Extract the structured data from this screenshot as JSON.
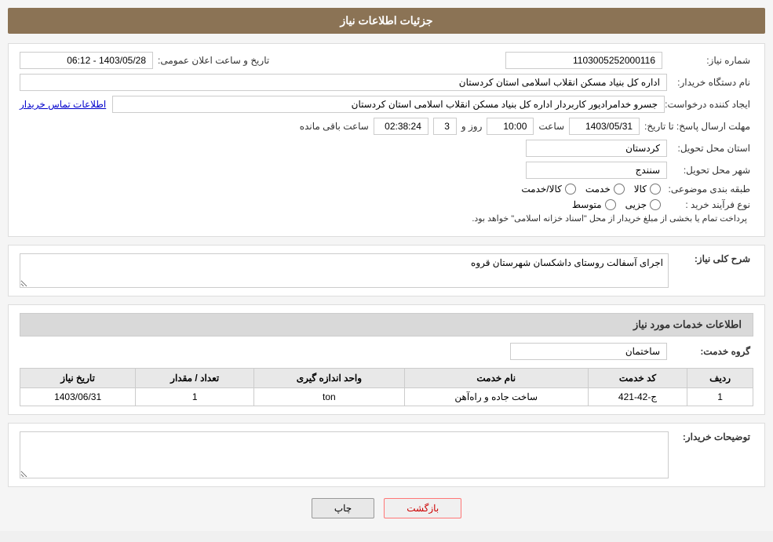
{
  "page": {
    "title": "جزئیات اطلاعات نیاز"
  },
  "header": {
    "number_label": "شماره نیاز:",
    "number_value": "1103005252000116",
    "date_label": "تاریخ و ساعت اعلان عمومی:",
    "date_value": "1403/05/28 - 06:12"
  },
  "buyer_org_label": "نام دستگاه خریدار:",
  "buyer_org_value": "اداره کل بنیاد مسکن انقلاب اسلامی استان کردستان",
  "creator_label": "ایجاد کننده درخواست:",
  "creator_value": "جسرو خدامرادیور کاربردار اداره کل بنیاد مسکن انقلاب اسلامی استان کردستان",
  "contact_link": "اطلاعات تماس خریدار",
  "deadline_label": "مهلت ارسال پاسخ: تا تاریخ:",
  "deadline_date": "1403/05/31",
  "deadline_time_label": "ساعت",
  "deadline_time": "10:00",
  "deadline_days_label": "روز و",
  "deadline_days": "3",
  "deadline_remaining_label": "ساعت باقی مانده",
  "deadline_remaining": "02:38:24",
  "province_label": "استان محل تحویل:",
  "province_value": "کردستان",
  "city_label": "شهر محل تحویل:",
  "city_value": "سنندج",
  "category_label": "طبقه بندی موضوعی:",
  "category_options": [
    {
      "label": "کالا",
      "selected": false
    },
    {
      "label": "خدمت",
      "selected": false
    },
    {
      "label": "کالا/خدمت",
      "selected": false
    }
  ],
  "purchase_type_label": "نوع فرآیند خرید :",
  "purchase_type_options": [
    {
      "label": "جزیی",
      "selected": false
    },
    {
      "label": "متوسط",
      "selected": false
    }
  ],
  "purchase_note": "پرداخت تمام یا بخشی از مبلغ خریدار از محل \"اسناد خزانه اسلامی\" خواهد بود.",
  "description_section_title": "شرح کلی نیاز:",
  "description_value": "اجرای آسفالت روستای داشکسان شهرستان قروه",
  "services_section_title": "اطلاعات خدمات مورد نیاز",
  "service_group_label": "گروه خدمت:",
  "service_group_value": "ساختمان",
  "table": {
    "headers": [
      "ردیف",
      "کد خدمت",
      "نام خدمت",
      "واحد اندازه گیری",
      "تعداد / مقدار",
      "تاریخ نیاز"
    ],
    "rows": [
      {
        "row": "1",
        "code": "ج-42-421",
        "name": "ساخت جاده و راه‌آهن",
        "unit": "ton",
        "qty": "1",
        "date": "1403/06/31"
      }
    ]
  },
  "buyer_desc_label": "توضیحات خریدار:",
  "buyer_desc_value": "",
  "buttons": {
    "print": "چاپ",
    "back": "بازگشت"
  }
}
